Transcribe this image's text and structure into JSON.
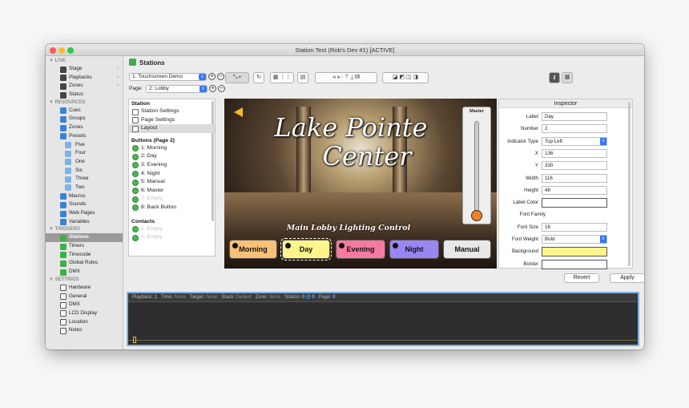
{
  "window": {
    "title": "Station Test (Rob's Dev #1) [ACTIVE]"
  },
  "sidebar": {
    "sections": [
      {
        "label": "LIVE",
        "items": [
          {
            "label": "Stage",
            "icon": "stage-icon",
            "chevron": true
          },
          {
            "label": "Playbacks",
            "icon": "playbacks-icon",
            "chevron": true
          },
          {
            "label": "Zones",
            "icon": "zones-icon",
            "chevron": true
          },
          {
            "label": "Status",
            "icon": "info-icon"
          }
        ]
      },
      {
        "label": "RESOURCES",
        "items": [
          {
            "label": "Cues",
            "icon": "cues-icon"
          },
          {
            "label": "Groups",
            "icon": "groups-icon"
          },
          {
            "label": "Zones",
            "icon": "zones-icon"
          },
          {
            "label": "Presets",
            "icon": "presets-icon",
            "expanded": true
          },
          {
            "label": "Five",
            "icon": "preset-icon",
            "sub": true
          },
          {
            "label": "Four",
            "icon": "preset-icon",
            "sub": true
          },
          {
            "label": "One",
            "icon": "preset-icon",
            "sub": true
          },
          {
            "label": "Six",
            "icon": "preset-icon",
            "sub": true
          },
          {
            "label": "Three",
            "icon": "preset-icon",
            "sub": true
          },
          {
            "label": "Two",
            "icon": "preset-icon",
            "sub": true
          },
          {
            "label": "Macros",
            "icon": "macros-icon"
          },
          {
            "label": "Sounds",
            "icon": "sounds-icon"
          },
          {
            "label": "Web Pages",
            "icon": "globe-icon"
          },
          {
            "label": "Variables",
            "icon": "variables-icon"
          }
        ]
      },
      {
        "label": "TRIGGERS",
        "items": [
          {
            "label": "Stations",
            "icon": "stations-icon",
            "selected": true
          },
          {
            "label": "Timers",
            "icon": "timers-icon"
          },
          {
            "label": "Timecode",
            "icon": "timecode-icon"
          },
          {
            "label": "Global Rules",
            "icon": "rules-icon"
          },
          {
            "label": "DMX",
            "icon": "dmx-icon"
          }
        ]
      },
      {
        "label": "SETTINGS",
        "items": [
          {
            "label": "Hardware",
            "icon": "hardware-icon"
          },
          {
            "label": "General",
            "icon": "general-icon"
          },
          {
            "label": "DMX",
            "icon": "dmx-icon"
          },
          {
            "label": "LCD Display",
            "icon": "lcd-icon"
          },
          {
            "label": "Location",
            "icon": "location-icon"
          },
          {
            "label": "Notes",
            "icon": "notes-icon"
          }
        ]
      }
    ]
  },
  "header": {
    "title": "Stations"
  },
  "station_select": {
    "value": "1: Touchscreen Demo"
  },
  "page_select": {
    "label": "Page:",
    "value": "2: Lobby"
  },
  "tree": {
    "groups": [
      {
        "label": "Station",
        "items": [
          {
            "label": "Station Settings",
            "icon": "settings-icon"
          },
          {
            "label": "Page Settings",
            "icon": "edit-icon"
          },
          {
            "label": "Layout",
            "icon": "layout-icon",
            "selected": true
          }
        ]
      },
      {
        "label": "Buttons (Page 2)",
        "items": [
          {
            "label": "1: Morning"
          },
          {
            "label": "2: Day"
          },
          {
            "label": "3: Evening"
          },
          {
            "label": "4: Night"
          },
          {
            "label": "5: Manual"
          },
          {
            "label": "6: Master"
          },
          {
            "label": "7: Empty",
            "dim": true
          },
          {
            "label": "8: Back Button"
          }
        ]
      },
      {
        "label": "Contacts",
        "items": [
          {
            "label": "1: Empty",
            "dim": true
          },
          {
            "label": "2: Empty",
            "dim": true
          }
        ]
      }
    ]
  },
  "stage": {
    "title_line1": "Lake Pointe",
    "title_line2": "Center",
    "subtitle": "Main Lobby Lighting Control",
    "master_label": "Master",
    "master_level": 0.0,
    "buttons": [
      {
        "label": "Morning",
        "color": "#f9c177",
        "indicator": true
      },
      {
        "label": "Day",
        "color": "#fdf58a",
        "indicator": true,
        "selected": true
      },
      {
        "label": "Evening",
        "color": "#f57aa0",
        "indicator": true
      },
      {
        "label": "Night",
        "color": "#9a86f2",
        "indicator": true
      },
      {
        "label": "Manual",
        "color": "#e8e8e8",
        "indicator": false
      }
    ]
  },
  "inspector": {
    "title": "Inspector",
    "fields": [
      {
        "label": "Label",
        "value": "Day"
      },
      {
        "label": "Number",
        "value": "2"
      },
      {
        "label": "Indicator Type",
        "value": "Top Left",
        "select": true
      },
      {
        "label": "X",
        "value": "136"
      },
      {
        "label": "Y",
        "value": "330"
      },
      {
        "label": "Width",
        "value": "116"
      },
      {
        "label": "Height",
        "value": "48"
      },
      {
        "label": "Label Color",
        "swatch": "#ffffff"
      },
      {
        "label": "Font Family",
        "value": ""
      },
      {
        "label": "Font Size",
        "value": "16"
      },
      {
        "label": "Font Weight",
        "value": "Bold",
        "select": true
      },
      {
        "label": "Background",
        "swatch": "#fdf58a"
      },
      {
        "label": "Border",
        "swatch": "#ffffff"
      }
    ]
  },
  "actions": {
    "revert": "Revert",
    "apply": "Apply"
  },
  "console": {
    "status": [
      {
        "k": "Playback:",
        "v": "1",
        "style": "b"
      },
      {
        "k": "Time:",
        "v": "None",
        "style": "i"
      },
      {
        "k": "Target:",
        "v": "None",
        "style": "i"
      },
      {
        "k": "Stack:",
        "v": "Default",
        "style": "i"
      },
      {
        "k": "Zone:",
        "v": "None",
        "style": "i"
      },
      {
        "k": "Station:",
        "v": "0 @ 0",
        "style": "b"
      },
      {
        "k": "Page:",
        "v": "0",
        "style": "b"
      }
    ]
  }
}
